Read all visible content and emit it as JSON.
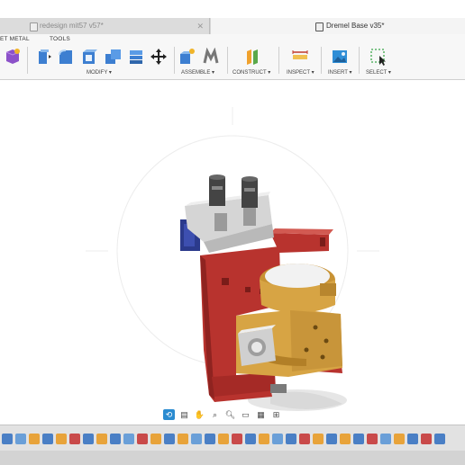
{
  "tabs": [
    {
      "label": "redesign mit57 v57*",
      "active": false
    },
    {
      "label": "Dremel Base v35*",
      "active": true
    }
  ],
  "toolbar": {
    "left_cut_label": "ET METAL",
    "tools_label": "TOOLS",
    "groups": {
      "modify": "MODIFY ▾",
      "assemble": "ASSEMBLE ▾",
      "construct": "CONSTRUCT ▾",
      "inspect": "INSPECT ▾",
      "insert": "INSERT ▾",
      "select": "SELECT ▾"
    }
  },
  "colors": {
    "accent": "#2a8bd0",
    "red_part": "#b8332e",
    "gold_part": "#d2a13c",
    "grey_part": "#cfcfcf"
  },
  "nav_icons": [
    "orbit-icon",
    "pan-icon",
    "hand-icon",
    "zoom-window-icon",
    "zoom-icon",
    "display-settings-icon",
    "grid-icon",
    "viewports-icon"
  ]
}
